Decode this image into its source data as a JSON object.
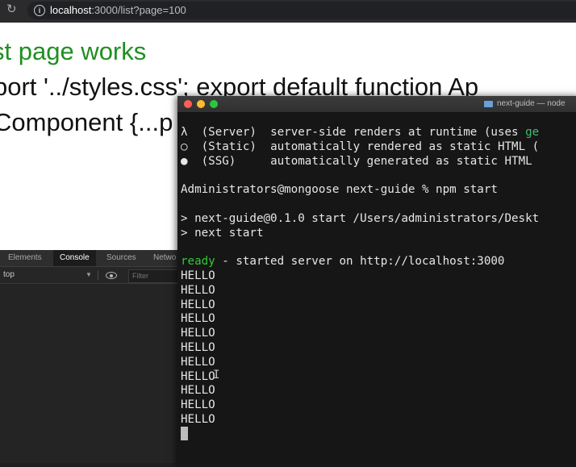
{
  "browser": {
    "url_host": "localhost",
    "url_rest": ":3000/list?page=100"
  },
  "page": {
    "heading": "st page works",
    "line2": "port '../styles.css'; export default function Ap",
    "line3": "Component {...p"
  },
  "devtools": {
    "tabs": [
      "Elements",
      "Console",
      "Sources",
      "Netwo"
    ],
    "active_tab": "Console",
    "context": "top",
    "filter_placeholder": "Filter"
  },
  "terminal": {
    "title": "next-guide — node",
    "legend": [
      {
        "symbol": "λ",
        "type": "(Server)",
        "desc": "server-side renders at runtime (uses ",
        "desc_tail": "ge"
      },
      {
        "symbol": "○",
        "type": "(Static)",
        "desc": "automatically rendered as static HTML (",
        "desc_tail": ""
      },
      {
        "symbol": "●",
        "type": "(SSG)",
        "desc": "automatically generated as static HTML",
        "desc_tail": ""
      }
    ],
    "prompt": "Administrators@mongoose next-guide % npm start",
    "npm_line1": "> next-guide@0.1.0 start /Users/administrators/Deskt",
    "npm_line2": "> next start",
    "ready_word": "ready",
    "ready_rest": " - started server on http://localhost:3000",
    "hello": [
      "HELLO",
      "HELLO",
      "HELLO",
      "HELLO",
      "HELLO",
      "HELLO",
      "HELLO",
      "HELLO",
      "HELLO",
      "HELLO",
      "HELLO"
    ],
    "colors": {
      "ready": "#37c737",
      "background": "#161616"
    }
  }
}
